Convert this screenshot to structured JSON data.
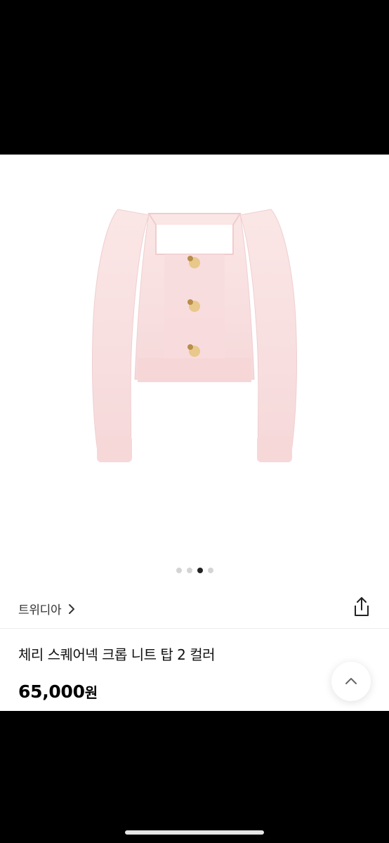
{
  "carousel": {
    "image_alt": "pink square-neck cropped knit top",
    "total": 4,
    "active_index": 2
  },
  "store": {
    "name": "트위디아",
    "chevron_icon": "chevron-right-icon"
  },
  "share": {
    "icon": "share-icon"
  },
  "product": {
    "title": "체리 스퀘어넥 크롭 니트 탑 2 컬러",
    "price": "65,000",
    "price_unit": "원"
  },
  "scroll_top": {
    "icon": "chevron-up-icon"
  },
  "colors": {
    "background": "#ffffff",
    "knit_pink": "#f9dfe0",
    "text_primary": "#111111",
    "text_secondary": "#333333",
    "dot_active": "#222222",
    "dot_inactive": "#d4d4d4"
  }
}
